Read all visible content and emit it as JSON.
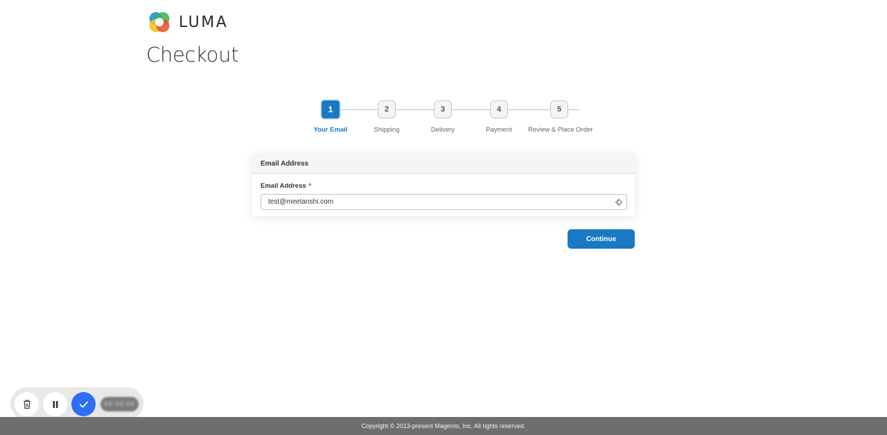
{
  "brand": {
    "logo_text": "LUMA",
    "colors": {
      "accent": "#1979c3",
      "required": "#e02b27"
    }
  },
  "page": {
    "title": "Checkout"
  },
  "progress": {
    "current_step": 1,
    "steps": [
      {
        "number": "1",
        "label": "Your Email"
      },
      {
        "number": "2",
        "label": "Shipping"
      },
      {
        "number": "3",
        "label": "Delivery"
      },
      {
        "number": "4",
        "label": "Payment"
      },
      {
        "number": "5",
        "label": "Review & Place Order"
      }
    ]
  },
  "email_section": {
    "header": "Email Address",
    "field_label": "Email Address",
    "required_marker": "*",
    "value": "test@meetanshi.com",
    "autofill_icon": "autofill-key-icon"
  },
  "actions": {
    "continue_label": "Continue"
  },
  "recorder_toolbar": {
    "buttons": [
      {
        "icon": "trash-icon"
      },
      {
        "icon": "pause-icon"
      },
      {
        "icon": "check-icon"
      }
    ],
    "timer": "00:00:00"
  },
  "footer": {
    "copyright": "Copyright © 2013-present Magento, Inc. All rights reserved."
  }
}
